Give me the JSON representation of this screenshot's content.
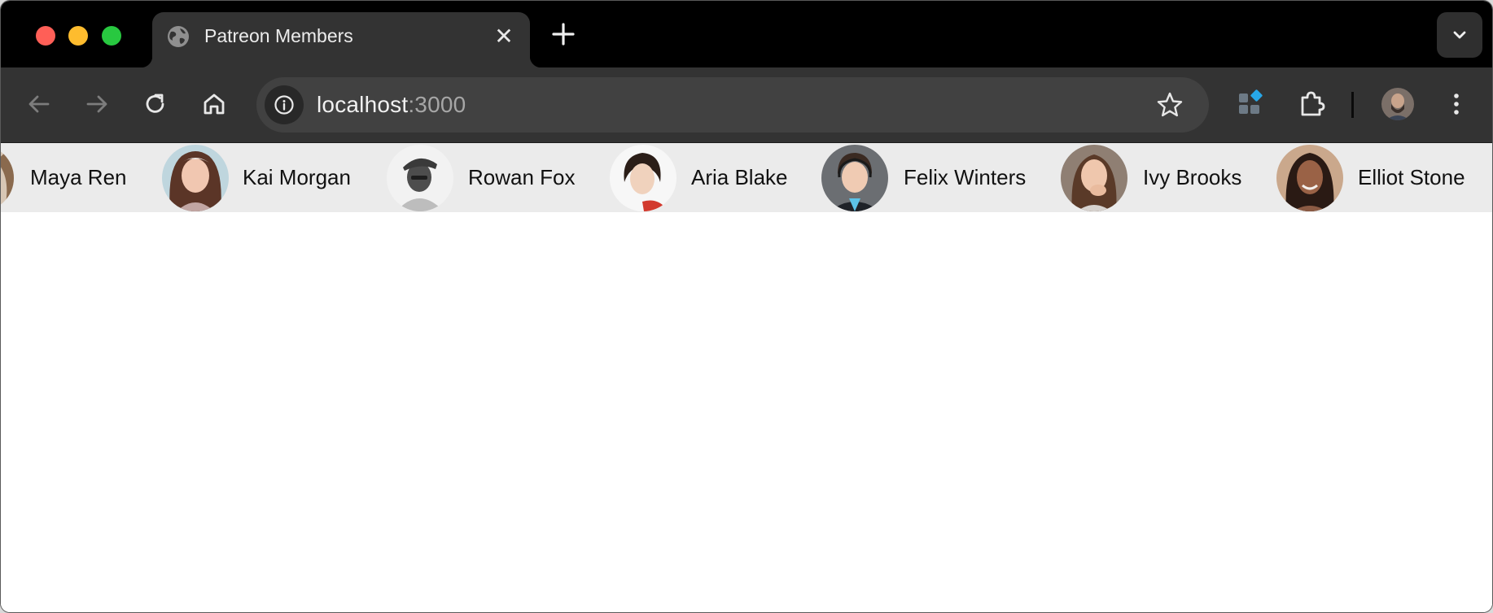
{
  "browser": {
    "tab": {
      "title": "Patreon Members",
      "icon": "globe-icon",
      "close_glyph": "✕"
    },
    "new_tab_icon": "plus-icon",
    "tab_search_icon": "chevron-down-icon",
    "toolbar": {
      "back_icon": "arrow-left-icon",
      "forward_icon": "arrow-right-icon",
      "reload_icon": "reload-icon",
      "home_icon": "home-icon"
    },
    "omnibox": {
      "security_icon": "info-icon",
      "url_host": "localhost",
      "url_port": ":3000",
      "bookmark_icon": "star-icon"
    },
    "extensions": {
      "app_icon": "apps-extension-icon",
      "puzzle_icon": "puzzle-icon",
      "menu_icon": "kebab-menu-icon"
    },
    "colors": {
      "tabstrip_bg": "#000000",
      "toolbar_bg": "#333333",
      "omnibox_bg": "#414141",
      "members_bar_bg": "#ebebeb"
    }
  },
  "members": [
    {
      "name": "Maya Ren",
      "avatar": "avatar-partial"
    },
    {
      "name": "Kai Morgan",
      "avatar": "avatar-woman-brown-hair"
    },
    {
      "name": "Rowan Fox",
      "avatar": "avatar-man-cap-bw"
    },
    {
      "name": "Aria Blake",
      "avatar": "avatar-woman-short-hair"
    },
    {
      "name": "Felix Winters",
      "avatar": "avatar-man-headset"
    },
    {
      "name": "Ivy Brooks",
      "avatar": "avatar-woman-pensive"
    },
    {
      "name": "Elliot Stone",
      "avatar": "avatar-woman-smiling"
    }
  ]
}
